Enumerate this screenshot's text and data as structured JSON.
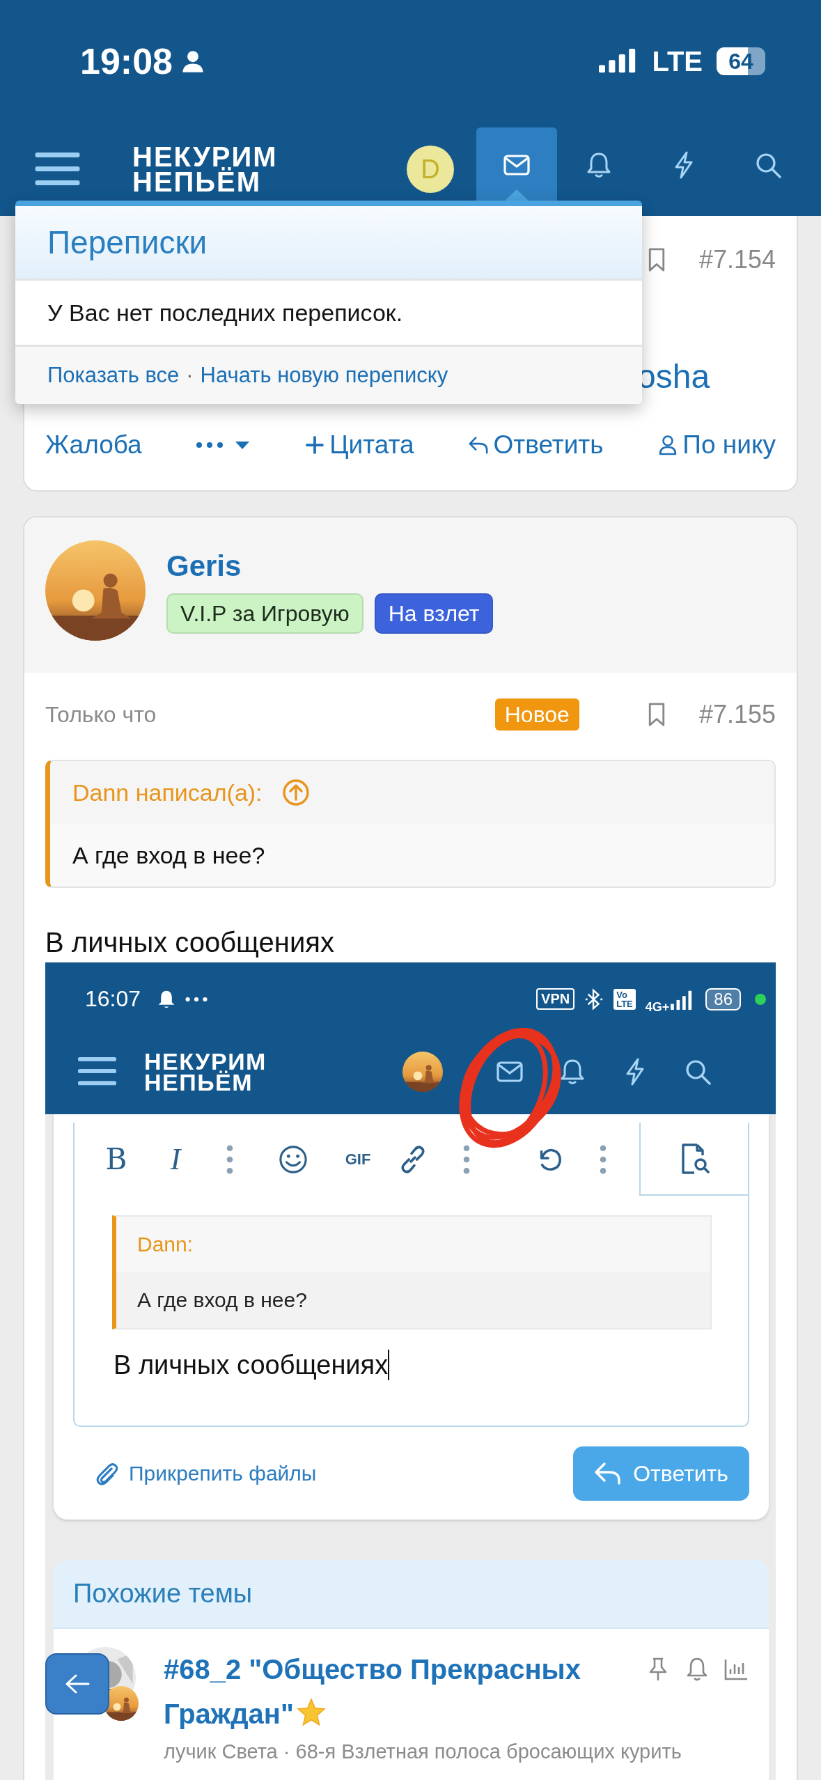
{
  "status_bar": {
    "time": "19:08",
    "network": "LTE",
    "battery": "64"
  },
  "header": {
    "logo": [
      "НЕКУРИМ",
      "НЕПЬЁМ"
    ],
    "avatar_letter": "D",
    "nav": [
      {
        "kind": "messages",
        "selected": true
      },
      {
        "kind": "alerts",
        "selected": false
      },
      {
        "kind": "whats_new",
        "selected": false
      },
      {
        "kind": "search",
        "selected": false
      }
    ]
  },
  "conversations_menu": {
    "title": "Переписки",
    "empty_text": "У Вас нет последних переписок.",
    "links": [
      "Показать все",
      "Начать новую переписку"
    ],
    "separator": "·"
  },
  "previous_post": {
    "number": "#7.154",
    "username": "osha",
    "actions": [
      {
        "kind": "report",
        "label": "Жалоба"
      },
      {
        "kind": "more"
      },
      {
        "kind": "quote",
        "label": "Цитата"
      },
      {
        "kind": "reply",
        "label": "Ответить"
      },
      {
        "kind": "mention",
        "label": "По нику"
      }
    ]
  },
  "post": {
    "username": "Geris",
    "badges": [
      {
        "label": "V.I.P за Игровую",
        "color": "#ccf3c4"
      },
      {
        "label": "На взлет",
        "color": "#3d63dc"
      }
    ],
    "time": "Только что",
    "new_label": "Новое",
    "number": "#7.155",
    "quote": {
      "author": "Dann написал(а):",
      "text": "А где вход в нее?"
    },
    "text": "В личных сообщениях",
    "screenshot": {
      "status_bar": {
        "time": "16:07",
        "vpn": "VPN",
        "volte": [
          "Vo",
          "LTE"
        ],
        "network": "4G+",
        "battery": "86"
      },
      "header": {
        "logo": [
          "НЕКУРИМ",
          "НЕПЬЁМ"
        ],
        "nav": [
          {
            "kind": "messages",
            "selected": false
          },
          {
            "kind": "alerts",
            "selected": false
          },
          {
            "kind": "whats_new",
            "selected": false
          },
          {
            "kind": "search",
            "selected": false
          }
        ]
      },
      "editor": {
        "toolbar": [
          {
            "kind": "bold",
            "label": "B"
          },
          {
            "kind": "italic",
            "label": "I"
          },
          {
            "kind": "more"
          },
          {
            "kind": "emoji"
          },
          {
            "kind": "gif",
            "label": "GIF"
          },
          {
            "kind": "link"
          },
          {
            "kind": "more"
          },
          {
            "kind": "undo"
          },
          {
            "kind": "more"
          }
        ],
        "quote": {
          "author": "Dann:",
          "text": "А где вход в нее?"
        },
        "value": "В личных сообщениях"
      },
      "attach_label": "Прикрепить файлы",
      "reply_label": "Ответить",
      "similar_threads": {
        "title": "Похожие темы",
        "threads": [
          {
            "title": "#68_2 \"Общество Прекрасных Граждан\"",
            "meta": "лучик Света · 68-я Взлетная полоса бросающих курить"
          }
        ]
      }
    }
  }
}
